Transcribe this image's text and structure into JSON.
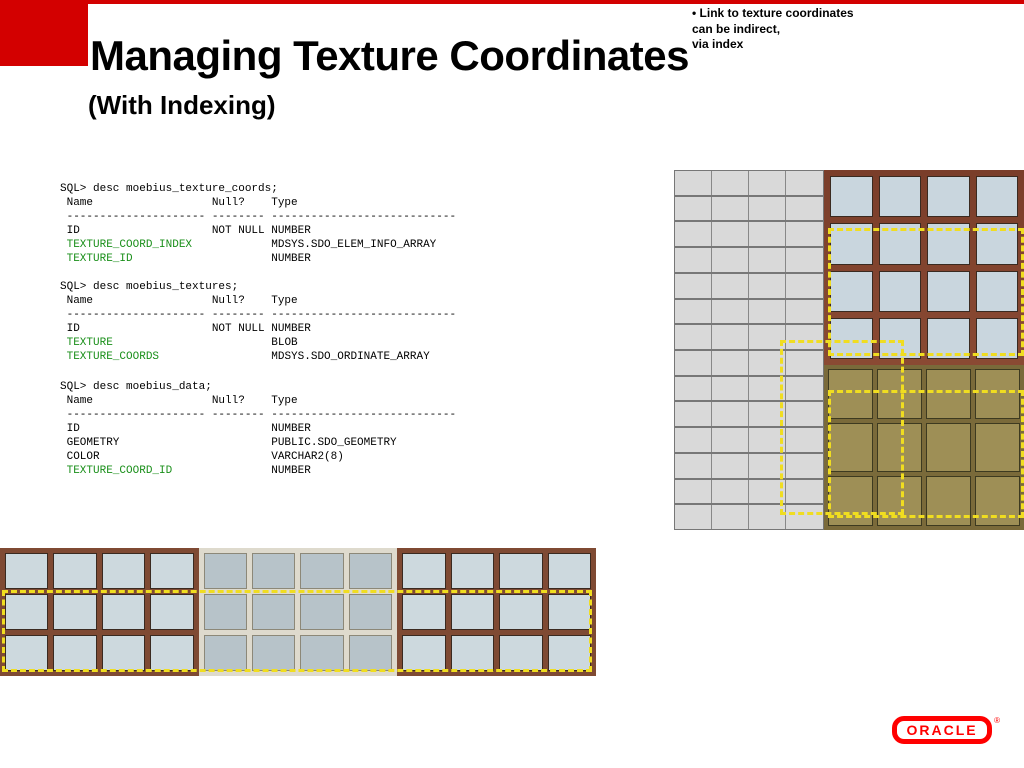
{
  "annotation": {
    "line1": "• Link to texture coordinates",
    "line2": "can be indirect,",
    "line3": "via index"
  },
  "title": "Managing Texture Coordinates",
  "subtitle": "(With Indexing)",
  "sql1": {
    "l1": "SQL> desc moebius_texture_coords;",
    "l2": " Name                  Null?    Type",
    "l3": " --------------------- -------- ----------------------------",
    "l4": " ID                    NOT NULL NUMBER",
    "l5f": " TEXTURE_COORD_INDEX",
    "l5v": "            MDSYS.SDO_ELEM_INFO_ARRAY",
    "l6f": " TEXTURE_ID",
    "l6v": "                     NUMBER"
  },
  "sql2": {
    "l1": "SQL> desc moebius_textures;",
    "l2": " Name                  Null?    Type",
    "l3": " --------------------- -------- ----------------------------",
    "l4": " ID                    NOT NULL NUMBER",
    "l5f": " TEXTURE",
    "l5v": "                        BLOB",
    "l6f": " TEXTURE_COORDS",
    "l6v": "                 MDSYS.SDO_ORDINATE_ARRAY"
  },
  "sql3": {
    "l1": "SQL> desc moebius_data;",
    "l2": " Name                  Null?    Type",
    "l3": " --------------------- -------- ----------------------------",
    "l4": " ID                             NUMBER",
    "l5": " GEOMETRY                       PUBLIC.SDO_GEOMETRY",
    "l6": " COLOR                          VARCHAR2(8)",
    "l7f": " TEXTURE_COORD_ID",
    "l7v": "               NUMBER"
  },
  "logo": {
    "text": "ORACLE",
    "reg": "®"
  }
}
